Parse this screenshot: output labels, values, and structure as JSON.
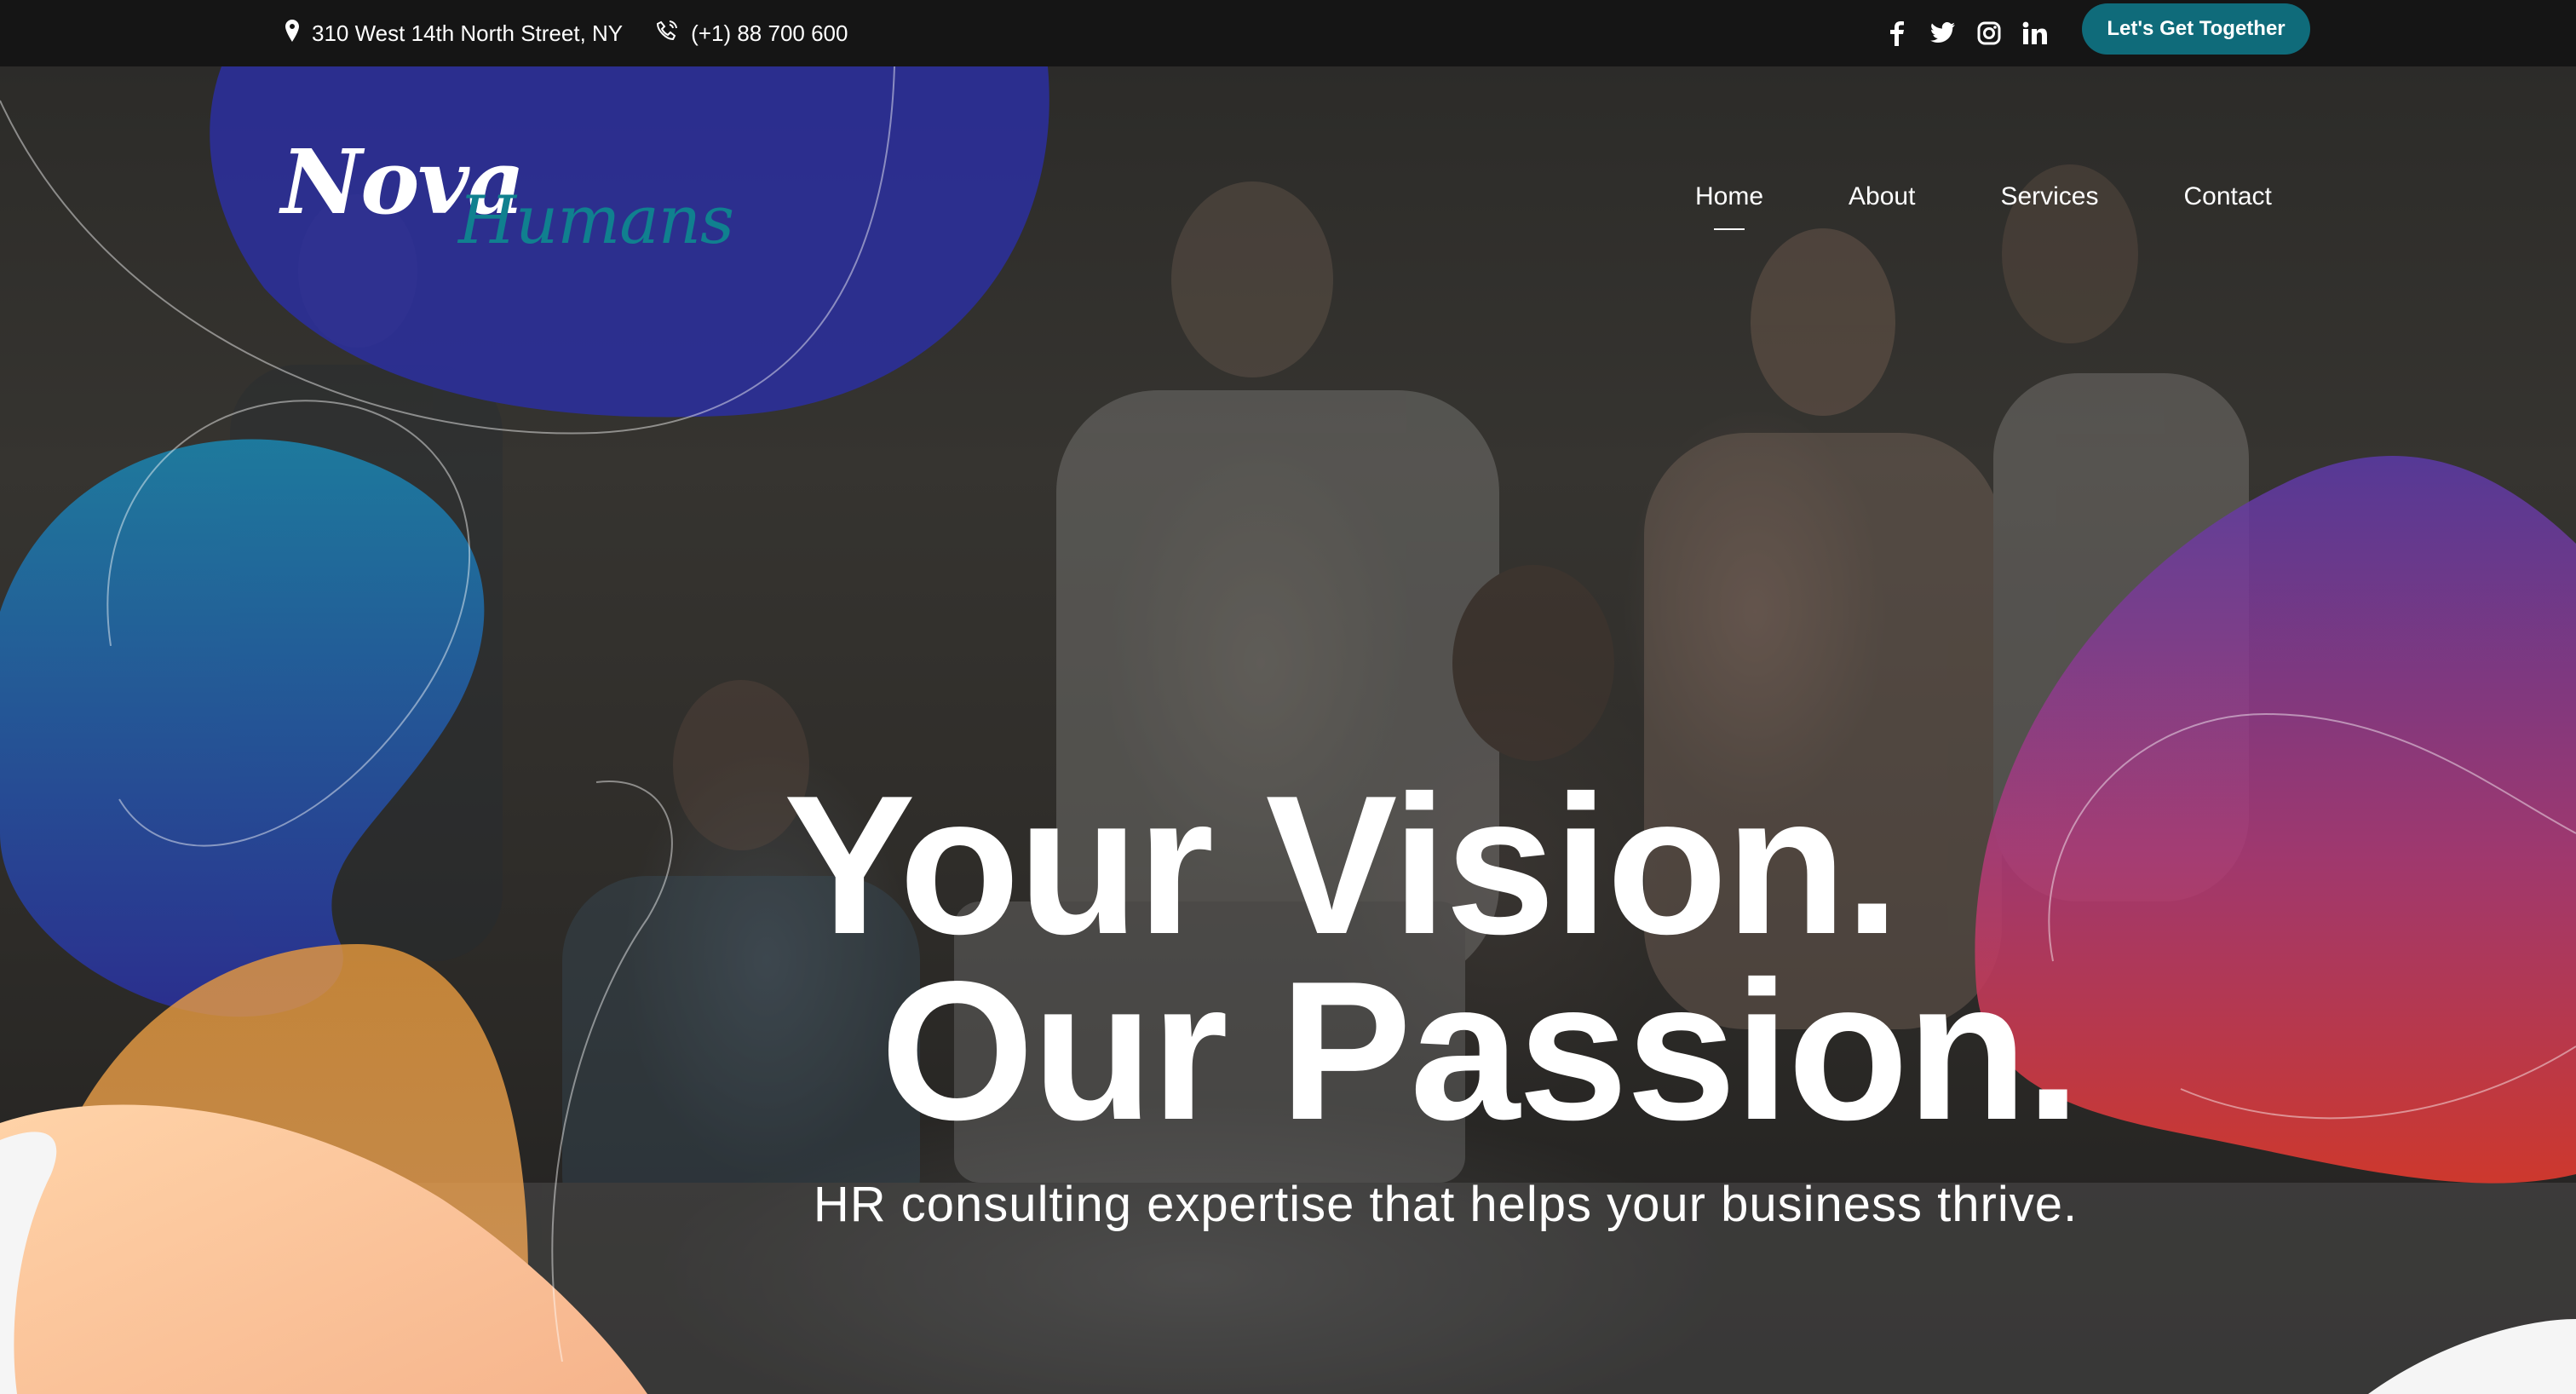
{
  "topbar": {
    "address": "310 West 14th North Street, NY",
    "phone": "(+1) 88 700 600",
    "social": [
      "facebook-icon",
      "twitter-icon",
      "instagram-icon",
      "linkedin-icon"
    ],
    "cta_label": "Let's Get Together"
  },
  "brand": {
    "logo_word1": "Nova",
    "logo_word2": "Humans",
    "accent_color": "#0f6b7a"
  },
  "nav": {
    "items": [
      {
        "label": "Home",
        "active": true
      },
      {
        "label": "About",
        "active": false
      },
      {
        "label": "Services",
        "active": false
      },
      {
        "label": "Contact",
        "active": false
      }
    ]
  },
  "hero": {
    "headline_line1": "Your Vision.",
    "headline_line2": "Our Passion.",
    "subheadline": "HR consulting expertise that helps your business thrive."
  },
  "colors": {
    "blob_blue": "#2b2fa0",
    "blob_teal": "#1a7fa8",
    "blob_orange": "#e6953a",
    "blob_peach": "#f7c29a",
    "blob_purple": "#5b3a9c",
    "blob_red": "#d93a3a"
  }
}
